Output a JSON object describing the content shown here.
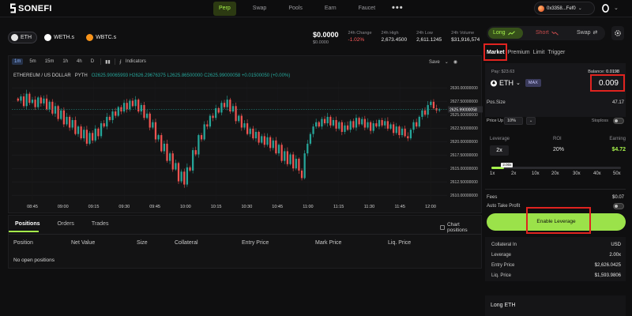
{
  "brand": {
    "name": "SONEFI"
  },
  "nav": {
    "links": [
      "Perp",
      "Swap",
      "Pools",
      "Earn",
      "Faucet"
    ],
    "active_index": 0,
    "more": "•••"
  },
  "wallet": {
    "address": "0x3358...Fef0",
    "chevron": "⌄"
  },
  "tokens": [
    {
      "label": "ETH",
      "icon": "eth-icon"
    },
    {
      "label": "WETH.s",
      "icon": "weth-icon"
    },
    {
      "label": "WBTC.s",
      "icon": "wbtc-icon"
    }
  ],
  "market": {
    "price": "$0.0000",
    "price_sub": "$0.0000",
    "stats": [
      {
        "label": "24h Change",
        "value": "-1.02%",
        "negative": true
      },
      {
        "label": "24h High",
        "value": "2,673.4500"
      },
      {
        "label": "24h Low",
        "value": "2,611.1245"
      },
      {
        "label": "24h Volume",
        "value": "$31,916,574"
      }
    ]
  },
  "chart_toolbar": {
    "timeframes": [
      "1m",
      "5m",
      "15m",
      "1h",
      "4h",
      "D"
    ],
    "active_timeframe": 0,
    "indicators": "Indicators",
    "save": "Save"
  },
  "chart_legend": {
    "pair": "ETHEREUM / US DOLLAR",
    "source": "PYTH",
    "ohlc": "O2625.90065993  H2626.29676375  L2625.86500000  C2625.99000058  +0.01500050 (+0.00%)"
  },
  "chart_data": {
    "type": "candlestick",
    "x_ticks": [
      "08:45",
      "09:00",
      "09:15",
      "09:30",
      "09:45",
      "10:00",
      "10:15",
      "10:30",
      "10:45",
      "11:00",
      "11:15",
      "11:30",
      "11:45",
      "12:00"
    ],
    "y_ticks": [
      2630.0,
      2627.5,
      2625.0,
      2622.5,
      2620.0,
      2617.5,
      2615.0,
      2612.5,
      2610.0
    ],
    "y_tick_labels": [
      "2630.00000000",
      "2627.50000000",
      "2625.00000000",
      "2622.50000000",
      "2620.00000000",
      "2617.50000000",
      "2615.00000000",
      "2612.50000000",
      "2610.00000000"
    ],
    "ylim": [
      2609.0,
      2631.2
    ],
    "last_price": 2625.99,
    "last_price_label": "2625.99000058",
    "up_color": "#26a69a",
    "down_color": "#ef5350",
    "closes": [
      2627.6,
      2628.4,
      2626.6,
      2628.9,
      2627.2,
      2627.8,
      2626.4,
      2628.2,
      2627.1,
      2628.0,
      2626.0,
      2627.4,
      2625.2,
      2626.6,
      2624.2,
      2625.8,
      2623.2,
      2624.6,
      2622.6,
      2624.0,
      2621.4,
      2622.8,
      2620.6,
      2622.2,
      2619.6,
      2621.6,
      2620.2,
      2622.4,
      2621.0,
      2623.4,
      2622.8,
      2624.6,
      2624.0,
      2625.6,
      2624.8,
      2626.4,
      2625.6,
      2627.2,
      2626.0,
      2627.6,
      2626.6,
      2627.8,
      2625.6,
      2626.8,
      2624.4,
      2625.2,
      2622.6,
      2623.6,
      2620.4,
      2621.2,
      2618.2,
      2619.6,
      2616.4,
      2617.8,
      2614.8,
      2616.0,
      2612.6,
      2614.4,
      2612.0,
      2615.2,
      2614.6,
      2618.4,
      2617.6,
      2621.2,
      2620.4,
      2623.2,
      2622.8,
      2624.8,
      2624.4,
      2626.2,
      2625.4,
      2627.2,
      2626.4,
      2627.8,
      2625.6,
      2626.6,
      2623.8,
      2624.8,
      2622.6,
      2623.4,
      2621.4,
      2622.4,
      2620.6,
      2621.8,
      2619.8,
      2621.0,
      2619.4,
      2620.8,
      2618.8,
      2620.2,
      2617.8,
      2619.4,
      2616.4,
      2618.2,
      2615.8,
      2617.6,
      2615.0,
      2616.8,
      2614.6,
      2613.2,
      2617.8,
      2619.6,
      2621.4,
      2622.8,
      2623.6,
      2622.8,
      2624.2,
      2623.4,
      2624.6,
      2623.0,
      2624.0,
      2622.4,
      2623.6,
      2621.8,
      2623.0,
      2622.2,
      2623.8,
      2622.6,
      2624.4,
      2623.2,
      2624.2,
      2622.6,
      2623.6,
      2622.0,
      2623.4,
      2622.8,
      2624.0,
      2623.0,
      2623.8,
      2622.4,
      2623.2,
      2621.6,
      2622.8,
      2621.2,
      2622.4,
      2621.0,
      2620.6,
      2622.2,
      2623.6,
      2622.8,
      2624.6,
      2625.8,
      2625.0,
      2626.8,
      2627.4,
      2626.2,
      2625.8,
      2626.0
    ]
  },
  "positions": {
    "tabs": [
      "Positions",
      "Orders",
      "Trades"
    ],
    "chart_positions": "Chart positions",
    "columns": [
      "Position",
      "Net Value",
      "Size",
      "Collateral",
      "Entry Price",
      "Mark Price",
      "Liq. Price"
    ],
    "empty": "No open positions"
  },
  "trade": {
    "side_tabs": [
      "Long",
      "Short",
      "Swap"
    ],
    "order_tabs": [
      "Market",
      "Premium",
      "Limit",
      "Trigger"
    ],
    "pay_label": "Pay: $23.63",
    "balance_label": "Balance:",
    "balance_value": "0.0198",
    "asset": "ETH",
    "max": "MAX",
    "amount": "0.009",
    "pos_size_label": "Pos.Size",
    "pos_size_value": "47.17",
    "price_up_label": "Price Up",
    "price_up_value": "10%",
    "stoploss_label": "Stoploss",
    "leverage_label": "Leverage",
    "roi_label": "ROI",
    "earning_label": "Earning",
    "leverage_value": "2x",
    "roi_value": "20%",
    "earning_value": "$4.72",
    "slider_tip": "2.00x",
    "slider_fraction": 0.1,
    "slider_ticks": [
      "1x",
      "2x",
      "10x",
      "20x",
      "30x",
      "40x",
      "50x"
    ],
    "fees_label": "Fees",
    "fees_value": "$0.07",
    "auto_tp_label": "Auto Take Profit",
    "enable_button": "Enable Leverage",
    "summary": [
      {
        "label": "Collateral In",
        "value": "USD"
      },
      {
        "label": "Leverage",
        "value": "2.00x"
      },
      {
        "label": "Entry Price",
        "value": "$2,626.0425"
      },
      {
        "label": "Liq. Price",
        "value": "$1,593.9806"
      }
    ],
    "footer_title": "Long ETH"
  },
  "colors": {
    "accent": "#a5f14b",
    "negative": "#ff5b5b",
    "highlight_box": "#e0231f"
  }
}
